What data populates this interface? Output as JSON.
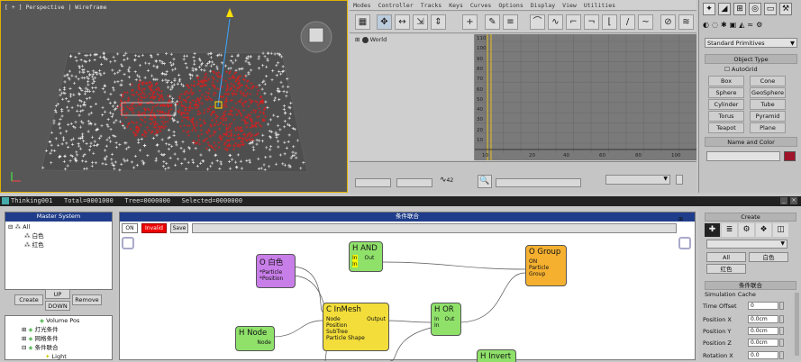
{
  "viewport": {
    "title": "[ + ] Perspective | Wireframe"
  },
  "curve_editor": {
    "menu": [
      "Modes",
      "Controller",
      "Tracks",
      "Keys",
      "Curves",
      "Options",
      "Display",
      "View",
      "Utilities"
    ],
    "tree_item": "World",
    "ticks": [
      "10",
      "20",
      "40",
      "60",
      "80",
      "100"
    ],
    "y_ticks": [
      "110",
      "100",
      "90",
      "80",
      "70",
      "60",
      "50",
      "40",
      "30",
      "20",
      "10"
    ],
    "field_value": "42"
  },
  "command_panel": {
    "dropdown": "Standard Primitives",
    "object_type": "Object Type",
    "autogrid": "AutoGrid",
    "buttons": [
      "Box",
      "Cone",
      "Sphere",
      "GeoSphere",
      "Cylinder",
      "Tube",
      "Torus",
      "Pyramid",
      "Teapot",
      "Plane"
    ],
    "name_color": "Name and Color",
    "swatch_color": "#a0142a"
  },
  "status": {
    "text": "Thinking001   Total=0001000   Tree=0000000   Selected=0000000"
  },
  "master": {
    "title": "Master System",
    "items": [
      "All",
      "白色",
      "红色"
    ],
    "create": "Create",
    "up": "UP",
    "down": "DOWN",
    "remove": "Remove"
  },
  "lower_tree": {
    "items": [
      "Volume Pos",
      "灯光条件",
      "网格条件",
      "条件联合",
      "Light"
    ]
  },
  "graph": {
    "title": "条件联合",
    "on": "ON",
    "invalid": "Invalid",
    "save": "Save"
  },
  "nodes": {
    "white": {
      "title": "O 白色",
      "ports": [
        "*Particle",
        "*Position"
      ]
    },
    "and": {
      "title": "H AND",
      "in1": "In",
      "out": "Out",
      "in2": "In"
    },
    "group": {
      "title": "O Group",
      "ports": [
        "ON",
        "Particle",
        "Group"
      ]
    },
    "inmesh": {
      "title": "C InMesh",
      "node": "Node",
      "output": "Output",
      "rest": [
        "Position",
        "SubTree",
        "Particle Shape"
      ]
    },
    "or": {
      "title": "H OR",
      "in1": "In",
      "out": "Out",
      "in2": "In"
    },
    "hnode": {
      "title": "H Node",
      "port": "Node"
    },
    "invert": {
      "title": "H Invert"
    }
  },
  "right_panel": {
    "create": "Create",
    "all": "All",
    "white": "白色",
    "red": "红色",
    "section": "条件联合",
    "cache": "Simulation Cache",
    "time_offset_label": "Time Offset",
    "time_offset": "0",
    "pos_x_label": "Position X",
    "pos_x": "0.0cm",
    "pos_y_label": "Position Y",
    "pos_y": "0.0cm",
    "pos_z_label": "Position Z",
    "pos_z": "0.0cm",
    "rot_x_label": "Rotation X",
    "rot_x": "0.0"
  }
}
